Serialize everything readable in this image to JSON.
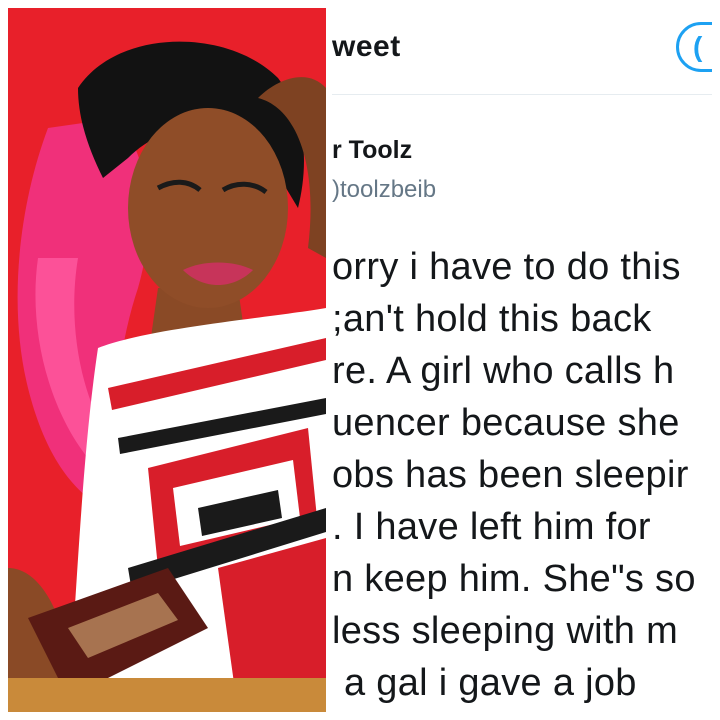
{
  "photo": {
    "description_icon": "portrait-photo",
    "background_color": "#e8202a",
    "hair_color": "#f0307a",
    "dress_colors": [
      "#ffffff",
      "#d81e2a",
      "#1a1a1a"
    ]
  },
  "tweet": {
    "header_title": "weet",
    "follow_button_label": "(",
    "author_name": "r Toolz",
    "author_handle": ")toolzbeib",
    "lines": [
      "orry i have to do this",
      ";an't hold this back",
      "re. A girl who calls h",
      "uencer because she",
      "obs has been sleepir",
      ". I have left him for",
      "n keep him. She\"s so",
      "less sleeping with m",
      "a gal i gave a job"
    ],
    "accent_color": "#1da1f2"
  }
}
